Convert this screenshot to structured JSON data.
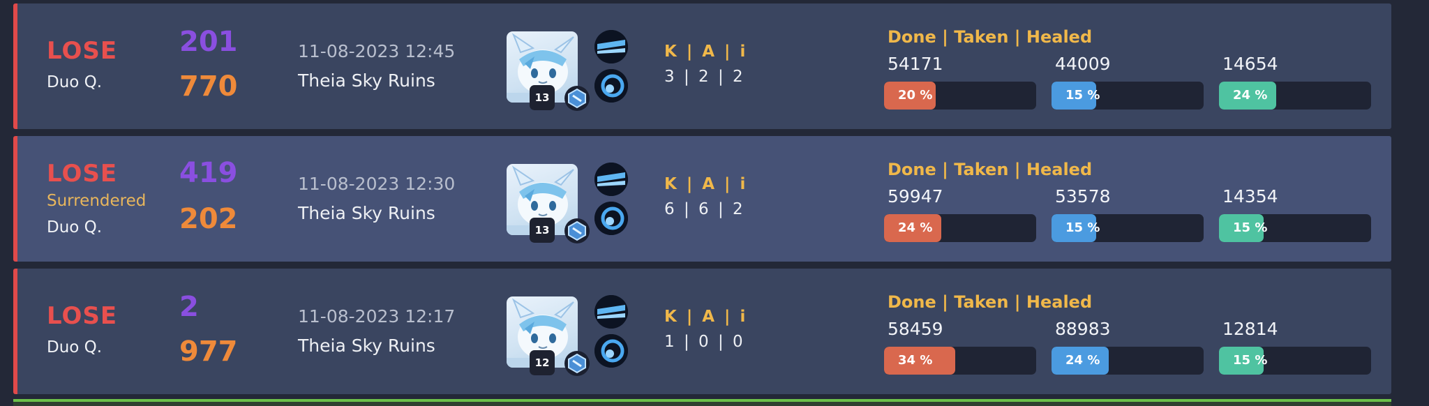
{
  "headers": {
    "kai_label": "K | A | i",
    "stats_label": "Done | Taken | Healed"
  },
  "colors": {
    "lose": "#e8504e",
    "done": "#d9684e",
    "taken": "#4b9be0",
    "healed": "#4fc3a1"
  },
  "matches": [
    {
      "result": "LOSE",
      "status": "",
      "mode": "Duo Q.",
      "score_purple": "201",
      "score_orange": "770",
      "date": "11-08-2023 12:45",
      "map": "Theia Sky Ruins",
      "pokemon_icon": "glaceon-portrait-icon",
      "level": "13",
      "kai": "3 | 2 | 2",
      "done": "54171",
      "taken": "44009",
      "healed": "14654",
      "done_pct": 20,
      "taken_pct": 15,
      "healed_pct": 24,
      "done_label": "20 %",
      "taken_label": "15 %",
      "healed_label": "24 %"
    },
    {
      "result": "LOSE",
      "status": "Surrendered",
      "mode": "Duo Q.",
      "score_purple": "419",
      "score_orange": "202",
      "date": "11-08-2023 12:30",
      "map": "Theia Sky Ruins",
      "pokemon_icon": "glaceon-portrait-icon",
      "level": "13",
      "kai": "6 | 6 | 2",
      "done": "59947",
      "taken": "53578",
      "healed": "14354",
      "done_pct": 24,
      "taken_pct": 15,
      "healed_pct": 15,
      "done_label": "24 %",
      "taken_label": "15 %",
      "healed_label": "15 %"
    },
    {
      "result": "LOSE",
      "status": "",
      "mode": "Duo Q.",
      "score_purple": "2",
      "score_orange": "977",
      "date": "11-08-2023 12:17",
      "map": "Theia Sky Ruins",
      "pokemon_icon": "glaceon-portrait-icon",
      "level": "12",
      "kai": "1 | 0 | 0",
      "done": "58459",
      "taken": "88983",
      "healed": "12814",
      "done_pct": 34,
      "taken_pct": 24,
      "healed_pct": 15,
      "done_label": "34 %",
      "taken_label": "24 %",
      "healed_label": "15 %"
    }
  ]
}
